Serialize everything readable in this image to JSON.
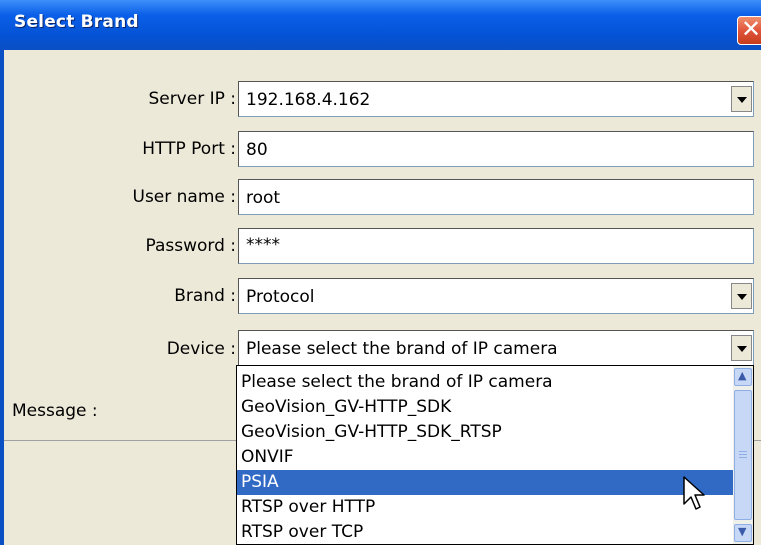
{
  "window": {
    "title": "Select Brand",
    "close_glyph": "✕"
  },
  "form": {
    "server_ip": {
      "label": "Server IP :",
      "value": "192.168.4.162"
    },
    "http_port": {
      "label": "HTTP Port :",
      "value": "80"
    },
    "user_name": {
      "label": "User name :",
      "value": "root"
    },
    "password": {
      "label": "Password :",
      "value": "****"
    },
    "brand": {
      "label": "Brand :",
      "value": "Protocol"
    },
    "device": {
      "label": "Device :",
      "value": "Please select the brand of IP camera"
    }
  },
  "message_label": "Message :",
  "device_list": {
    "items": [
      "Please select the brand of IP camera",
      "GeoVision_GV-HTTP_SDK",
      "GeoVision_GV-HTTP_SDK_RTSP",
      "ONVIF",
      "PSIA",
      "RTSP over HTTP",
      "RTSP over TCP"
    ],
    "selected": "PSIA"
  },
  "icons": {
    "dropdown": "chevron-down-icon",
    "scroll_up": "scroll-up-icon",
    "scroll_down": "scroll-down-icon",
    "cursor": "mouse-pointer-icon"
  },
  "colors": {
    "titlebar": "#0553d6",
    "selection": "#316ac5",
    "window_bg": "#ece9d8"
  }
}
